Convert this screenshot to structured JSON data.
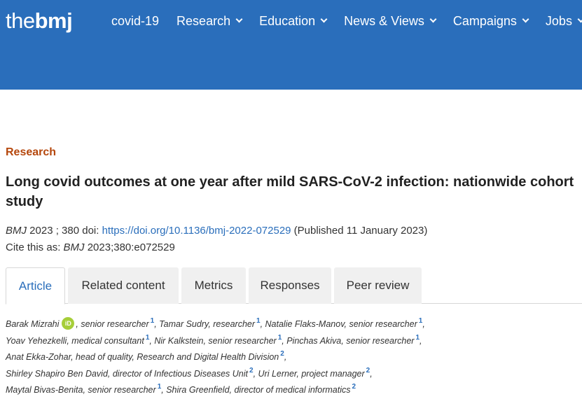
{
  "header": {
    "logo_light": "the",
    "logo_bold": "bmj",
    "nav": [
      {
        "label": "covid-19",
        "dropdown": false
      },
      {
        "label": "Research",
        "dropdown": true
      },
      {
        "label": "Education",
        "dropdown": true
      },
      {
        "label": "News & Views",
        "dropdown": true
      },
      {
        "label": "Campaigns",
        "dropdown": true
      },
      {
        "label": "Jobs",
        "dropdown": true
      }
    ]
  },
  "article": {
    "section": "Research",
    "title": "Long covid outcomes at one year after mild SARS-CoV-2 infection: nationwide cohort study",
    "journal": "BMJ",
    "year_vol": " 2023 ; 380  doi: ",
    "doi_link": "https://doi.org/10.1136/bmj-2022-072529",
    "published": " (Published 11 January 2023)",
    "cite_prefix": "Cite this as: ",
    "cite_journal": "BMJ",
    "cite_ref": " 2023;380:e072529"
  },
  "tabs": [
    "Article",
    "Related content",
    "Metrics",
    "Responses",
    "Peer review"
  ],
  "authors": {
    "line1": {
      "a1": "Barak Mizrahi",
      "orcid": "iD",
      "a1_role": ", senior researcher",
      "a1_sup": "1",
      "a2": ",  Tamar Sudry, researcher",
      "a2_sup": "1",
      "a3": ",  Natalie Flaks-Manov, senior researcher",
      "a3_sup": "1",
      "end": ","
    },
    "line2": {
      "a1": "Yoav Yehezkelli, medical consultant",
      "a1_sup": "1",
      "a2": ",  Nir Kalkstein, senior researcher",
      "a2_sup": "1",
      "a3": ",  Pinchas Akiva, senior researcher",
      "a3_sup": "1",
      "end": ","
    },
    "line3": {
      "a1": "Anat Ekka-Zohar, head of quality, Research and Digital Health Division",
      "a1_sup": "2",
      "end": ","
    },
    "line4": {
      "a1": "Shirley Shapiro Ben David, director of Infectious Diseases Unit",
      "a1_sup": "2",
      "a2": ",  Uri Lerner, project manager",
      "a2_sup": "2",
      "end": ","
    },
    "line5": {
      "a1": "Maytal Bivas-Benita, senior researcher",
      "a1_sup": "1",
      "a2": ",  Shira Greenfield, director of medical informatics",
      "a2_sup": "2"
    }
  },
  "colors": {
    "header_bg": "#2a6ebb",
    "section_label": "#b5470c",
    "link": "#2a6ebb",
    "orcid": "#a6ce39"
  }
}
